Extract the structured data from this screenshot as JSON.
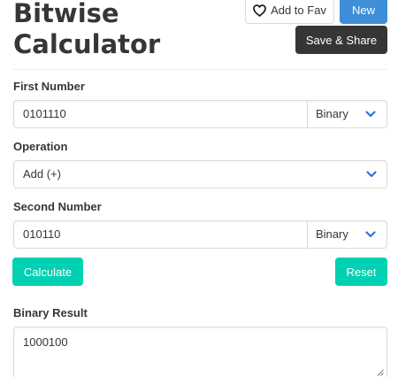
{
  "title": {
    "line1": "Bitwise",
    "line2": "Calculator"
  },
  "toolbar": {
    "fav_label": "Add to Fav",
    "new_label": "New",
    "save_label": "Save & Share"
  },
  "form": {
    "first_number": {
      "label": "First Number",
      "value": "0101110",
      "unit": "Binary"
    },
    "operation": {
      "label": "Operation",
      "value": "Add (+)"
    },
    "second_number": {
      "label": "Second Number",
      "value": "010110",
      "unit": "Binary"
    }
  },
  "actions": {
    "calculate_label": "Calculate",
    "reset_label": "Reset"
  },
  "result": {
    "label": "Binary Result",
    "value": "1000100"
  },
  "colors": {
    "new_button": "#3f8ed8",
    "save_button": "#363636",
    "primary": "#00d1b2",
    "chevron": "#3273dc",
    "border": "#dbdbdb",
    "text": "#363636"
  },
  "icons": {
    "fav": "heart-outline-icon",
    "dropdown": "chevron-down-icon",
    "resize": "resize-grip-icon"
  }
}
